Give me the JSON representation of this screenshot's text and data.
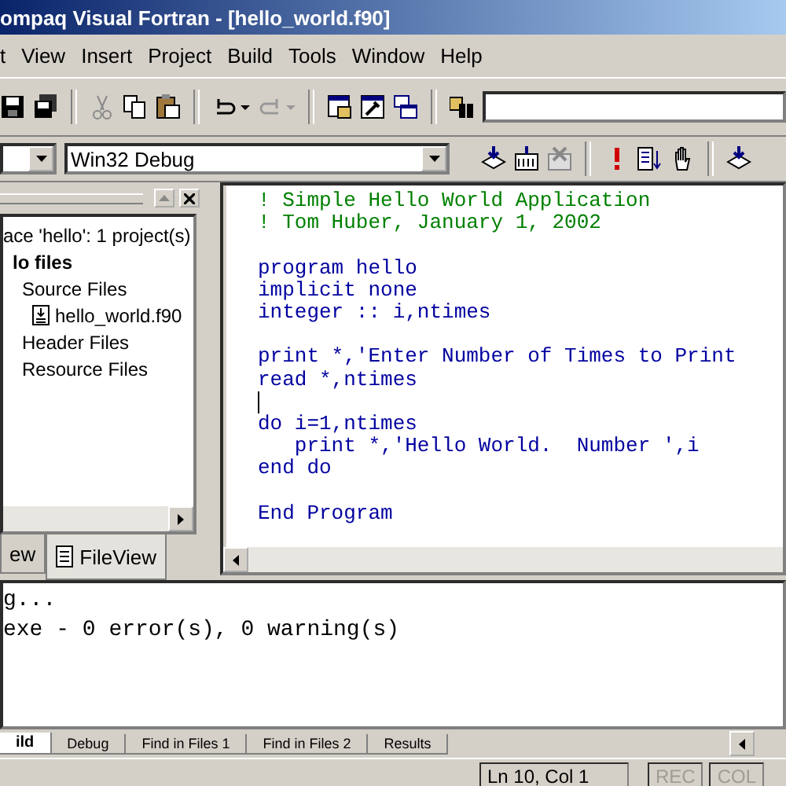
{
  "window": {
    "title": "ompaq Visual Fortran - [hello_world.f90]"
  },
  "menu": [
    "t",
    "View",
    "Insert",
    "Project",
    "Build",
    "Tools",
    "Window",
    "Help"
  ],
  "config_bar": {
    "config_combo": {
      "value": "Win32 Debug"
    }
  },
  "workspace": {
    "tree": [
      {
        "label": "ace 'hello': 1 project(s)",
        "bold": false,
        "children": [
          {
            "label": "lo files",
            "bold": true,
            "children": [
              {
                "label": "Source Files",
                "bold": false,
                "children": [
                  {
                    "label": "hello_world.f90",
                    "bold": false,
                    "kind": "file"
                  }
                ]
              },
              {
                "label": "Header Files",
                "bold": false
              },
              {
                "label": "Resource Files",
                "bold": false
              }
            ]
          }
        ]
      }
    ],
    "tabs": [
      {
        "label": "ew",
        "selected": false
      },
      {
        "label": "FileView",
        "selected": true
      }
    ]
  },
  "editor": {
    "lines": [
      {
        "kind": "comment",
        "text": "! Simple Hello World Application",
        "caret": false
      },
      {
        "kind": "comment",
        "text": "! Tom Huber, January 1, 2002",
        "caret": false
      },
      {
        "kind": "blank",
        "caret": false
      },
      {
        "kind": "code",
        "text": "program hello",
        "caret": false
      },
      {
        "kind": "code",
        "text": "implicit none",
        "caret": false
      },
      {
        "kind": "code",
        "text": "integer :: i,ntimes",
        "caret": false
      },
      {
        "kind": "blank",
        "caret": false
      },
      {
        "kind": "code",
        "text": "print *,'Enter Number of Times to Print",
        "caret": false
      },
      {
        "kind": "code",
        "text": "read *,ntimes",
        "caret": false
      },
      {
        "kind": "blank",
        "caret": true
      },
      {
        "kind": "code",
        "text": "do i=1,ntimes",
        "caret": false
      },
      {
        "kind": "code",
        "text": "   print *,'Hello World.  Number ',i",
        "caret": false
      },
      {
        "kind": "code",
        "text": "end do",
        "caret": false
      },
      {
        "kind": "blank",
        "caret": false
      },
      {
        "kind": "code",
        "text": "End Program",
        "caret": false
      }
    ]
  },
  "output": {
    "lines": [
      "g...",
      "exe - 0 error(s), 0 warning(s)"
    ],
    "tabs": [
      {
        "label": "ild",
        "selected": true
      },
      {
        "label": "Debug",
        "selected": false
      },
      {
        "label": "Find in Files 1",
        "selected": false
      },
      {
        "label": "Find in Files 2",
        "selected": false
      },
      {
        "label": "Results",
        "selected": false
      }
    ]
  },
  "status_bar": {
    "position": "Ln 10, Col 1",
    "indicators": [
      {
        "label": "REC",
        "disabled": true
      },
      {
        "label": "COL",
        "disabled": true
      }
    ]
  }
}
